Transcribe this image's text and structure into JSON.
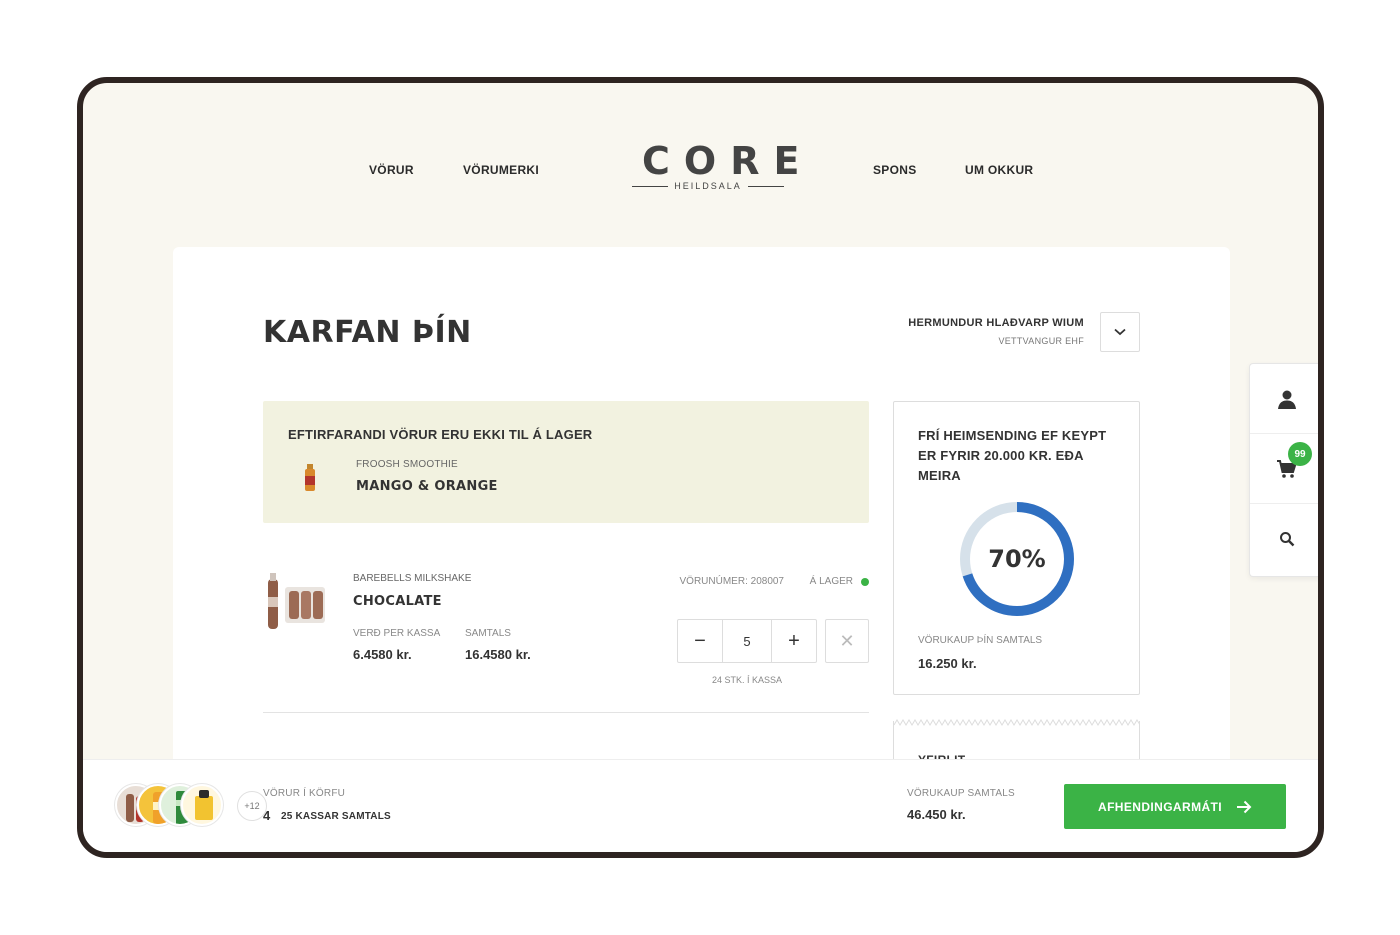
{
  "nav": {
    "products": "VÖRUR",
    "brands": "VÖRUMERKI",
    "spons": "SPONS",
    "about": "UM OKKUR"
  },
  "logo": {
    "word": "CORE",
    "sub": "HEILDSALA"
  },
  "page": {
    "title": "KARFAN ÞÍN"
  },
  "user": {
    "name": "HERMUNDUR HLAÐVARP WIUM",
    "company": "VETTVANGUR EHF"
  },
  "out_of_stock": {
    "title": "EFTIRFARANDI VÖRUR ERU EKKI TIL Á LAGER",
    "brand": "FROOSH SMOOTHIE",
    "name": "MANGO & ORANGE"
  },
  "cart_item": {
    "brand": "BAREBELLS MILKSHAKE",
    "name": "CHOCALATE",
    "sku_label": "VÖRUNÚMER: 208007",
    "stock_label": "Á LAGER",
    "price_label": "VERÐ PER KASSA",
    "price": "6.4580 kr.",
    "total_label": "SAMTALS",
    "total": "16.4580 kr.",
    "quantity": "5",
    "pack_note": "24 STK. Í KASSA",
    "minus": "−",
    "plus": "+",
    "remove": "✕"
  },
  "shipping": {
    "title": "FRÍ HEIMSENDING EF KEYPT ER FYRIR 20.000 KR. EÐA MEIRA",
    "percent_label": "70%",
    "progress": 0.7,
    "total_label": "VÖRUKAUP ÞÍN SAMTALS",
    "total": "16.250 kr."
  },
  "summary": {
    "title": "YFIRLIT"
  },
  "sidebar": {
    "cart_count": "99"
  },
  "footer": {
    "more_label": "+12",
    "items_label": "VÖRUR Í KÖRFU",
    "items_count": "4",
    "boxes_label": "25 KASSAR SAMTALS",
    "total_label": "VÖRUKAUP SAMTALS",
    "total": "46.450 kr.",
    "cta_label": "AFHENDINGARMÁTI"
  },
  "colors": {
    "accent_green": "#3bb346",
    "progress_blue": "#2f6fc1",
    "progress_track": "#d6e1ea",
    "frame": "#2e2421",
    "background": "#f9f7f0"
  },
  "icons": [
    "chevron-down-icon",
    "user-icon",
    "cart-icon",
    "search-icon",
    "arrow-right-icon",
    "close-icon"
  ]
}
